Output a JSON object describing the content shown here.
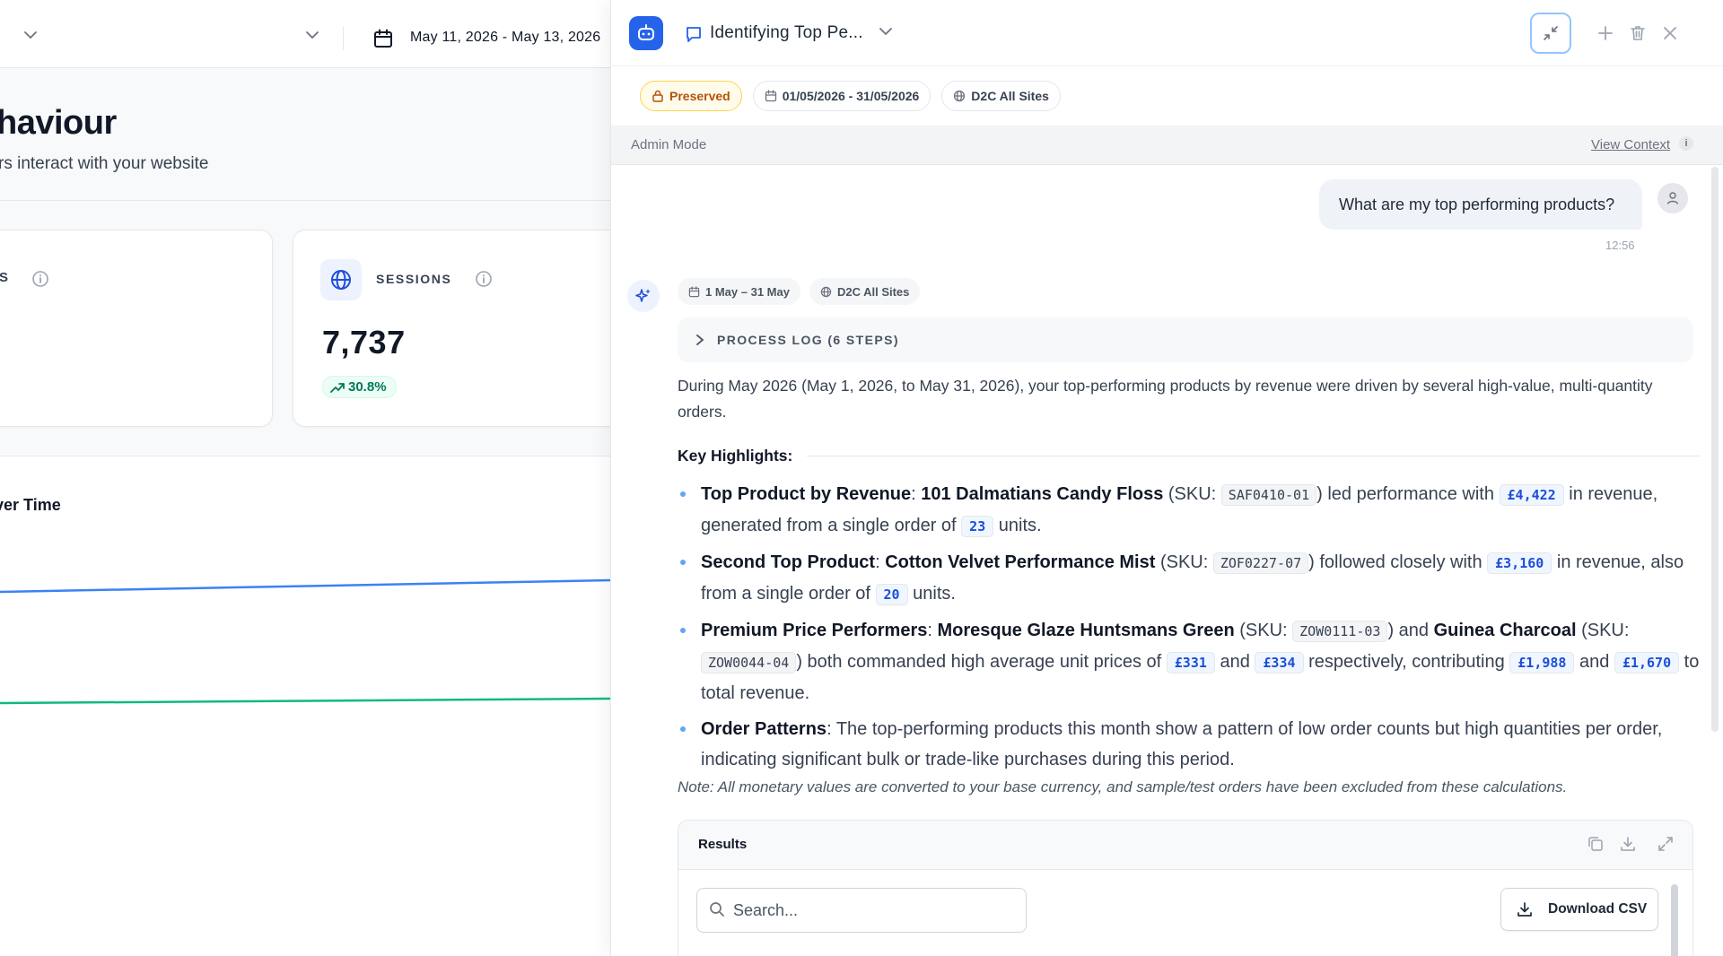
{
  "dashboard": {
    "date_range": "May 11, 2026 - May 13, 2026",
    "page_title": "haviour",
    "page_subtitle": "rs interact with your website",
    "card1_label": "S",
    "sessions": {
      "label": "SESSIONS",
      "value": "7,737",
      "delta": "30.8%"
    },
    "chart_title": "ver Time"
  },
  "colors": {
    "accent": "#2563eb",
    "line_blue": "#3b82f6",
    "line_green": "#10b981",
    "preserved": "#b45309"
  },
  "chat": {
    "title": "Identifying Top Pe...",
    "chips": {
      "preserved": "Preserved",
      "date": "01/05/2026 - 31/05/2026",
      "site": "D2C All Sites"
    },
    "admin_mode": "Admin Mode",
    "view_context": "View Context",
    "view_context_info": "i",
    "user_message": "What are my top performing products?",
    "user_time": "12:56",
    "ai_meta": {
      "range": "1 May – 31 May",
      "site": "D2C All Sites"
    },
    "process_log": "PROCESS LOG (6 STEPS)",
    "intro": "During May 2026 (May 1, 2026, to May 31, 2026), your top-performing products by revenue were driven by several high-value, multi-quantity orders.",
    "key_highlights": "Key Highlights:",
    "b1": {
      "label": "Top Product by Revenue",
      "colon": ": ",
      "name": "101 Dalmatians Candy Floss",
      "sku_open": " (SKU: ",
      "sku": "SAF0410-01",
      "mid": ") led performance with ",
      "revenue": "£4,422",
      "mid2": " in revenue, generated from a single order of ",
      "units": "23",
      "end": " units."
    },
    "b2": {
      "label": "Second Top Product",
      "colon": ": ",
      "name": "Cotton Velvet Performance Mist",
      "sku_open": " (SKU: ",
      "sku": "ZOF0227-07",
      "mid": ") followed closely with ",
      "revenue": "£3,160",
      "mid2": " in revenue, also from a single order of ",
      "units": "20",
      "end": " units."
    },
    "b3": {
      "label": "Premium Price Performers",
      "colon": ": ",
      "name1": "Moresque Glaze Huntsmans Green",
      "sku_open1": " (SKU: ",
      "sku1": "ZOW0111-03",
      "and1": ") and ",
      "name2": "Guinea Charcoal",
      "sku_open2": " (SKU: ",
      "sku2": "ZOW0044-04",
      "mid": ") both commanded high average unit prices of ",
      "price1": "£331",
      "and2": " and ",
      "price2": "£334",
      "mid2": " respectively, contributing ",
      "rev1": "£1,988",
      "and3": " and ",
      "rev2": "£1,670",
      "end": " to total revenue."
    },
    "b4": {
      "label": "Order Patterns",
      "text": ": The top-performing products this month show a pattern of low order counts but high quantities per order, indicating significant bulk or trade-like purchases during this period."
    },
    "note": "Note: All monetary values are converted to your base currency, and sample/test orders have been excluded from these calculations.",
    "results": {
      "title": "Results",
      "search_placeholder": "Search...",
      "download_csv": "Download CSV"
    }
  }
}
